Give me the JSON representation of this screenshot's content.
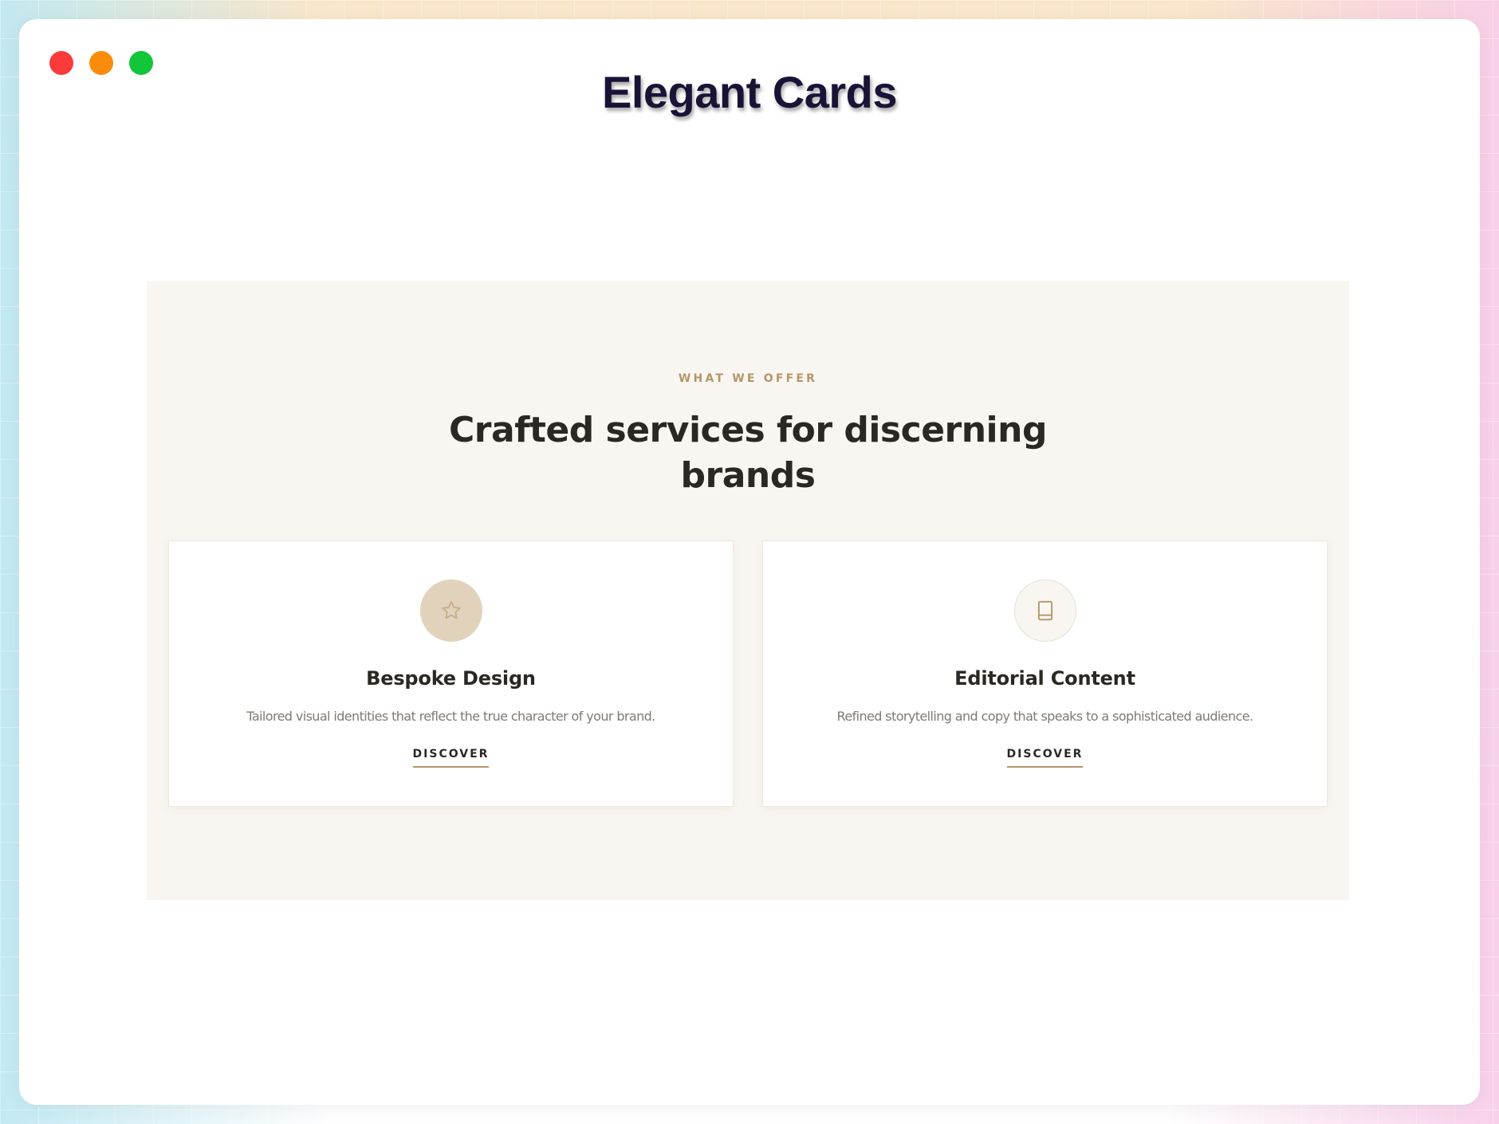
{
  "window": {
    "title": "Elegant Cards",
    "title_color": "#1a1336",
    "traffic_lights": [
      {
        "name": "close",
        "color": "#fb3b3b"
      },
      {
        "name": "minimize",
        "color": "#fb8c0b"
      },
      {
        "name": "maximize",
        "color": "#12c63a"
      }
    ]
  },
  "section": {
    "background": "#f9f6f1",
    "eyebrow": "WHAT WE OFFER",
    "eyebrow_color": "#b39668",
    "heading_line1": "Crafted services for discerning",
    "heading_line2": "brands",
    "heading_color": "#2b2824",
    "cards": [
      {
        "icon": "star-icon",
        "icon_bg": "#e1d2bb",
        "icon_color": "#c5ac85",
        "title": "Bespoke Design",
        "description": "Tailored visual identities that reflect the true character of your brand.",
        "link_label": "DISCOVER"
      },
      {
        "icon": "book-icon",
        "icon_bg": "#f9f6f1",
        "icon_color": "#b39668",
        "title": "Editorial Content",
        "description": "Refined storytelling and copy that speaks to a sophisticated audience.",
        "link_label": "DISCOVER"
      }
    ],
    "text_color": "#2b2824",
    "muted_color": "#7f7a74",
    "accent": "#b39668"
  }
}
